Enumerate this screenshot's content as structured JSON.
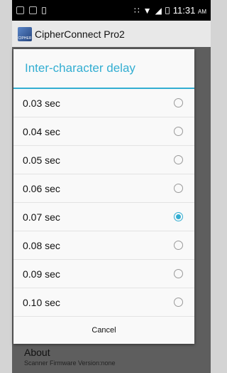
{
  "status_bar": {
    "time": "11:31",
    "ampm": "AM"
  },
  "app": {
    "title": "CipherConnect Pro2",
    "icon_label": "CIPHER"
  },
  "dialog": {
    "title": "Inter-character delay",
    "options": [
      {
        "label": "0.03 sec",
        "selected": false
      },
      {
        "label": "0.04 sec",
        "selected": false
      },
      {
        "label": "0.05 sec",
        "selected": false
      },
      {
        "label": "0.06 sec",
        "selected": false
      },
      {
        "label": "0.07 sec",
        "selected": true
      },
      {
        "label": "0.08 sec",
        "selected": false
      },
      {
        "label": "0.09 sec",
        "selected": false
      },
      {
        "label": "0.10 sec",
        "selected": false
      }
    ],
    "cancel_label": "Cancel"
  },
  "background": {
    "about_title": "About",
    "about_subtitle": "Scanner Firmware Version:none"
  },
  "colors": {
    "accent": "#33aed2"
  }
}
